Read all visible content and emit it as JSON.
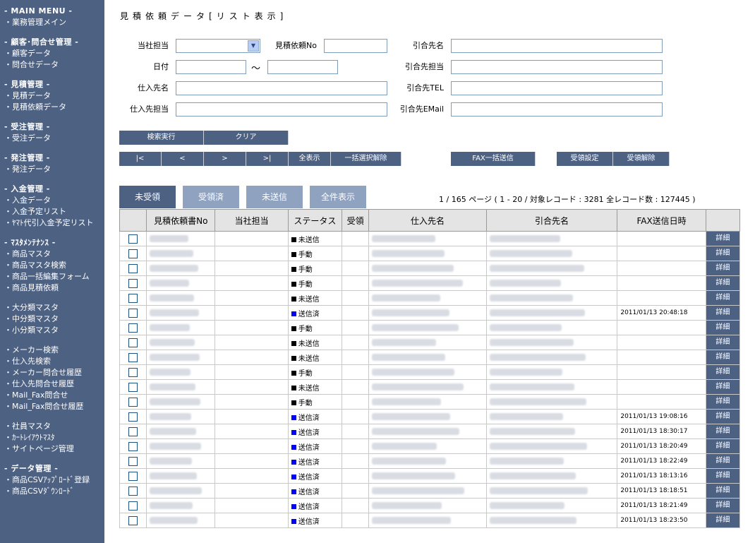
{
  "sidebar": {
    "groups": [
      {
        "head": "- MAIN MENU -",
        "items": [
          "・業務管理メイン"
        ]
      },
      {
        "head": "- 顧客･問合せ管理 -",
        "items": [
          "・顧客データ",
          "・問合せデータ"
        ]
      },
      {
        "head": "- 見積管理 -",
        "items": [
          "・見積データ",
          "・見積依頼データ"
        ]
      },
      {
        "head": "- 受注管理 -",
        "items": [
          "・受注データ"
        ]
      },
      {
        "head": "- 発注管理 -",
        "items": [
          "・発注データ"
        ]
      },
      {
        "head": "- 入金管理 -",
        "items": [
          "・入金データ",
          "・入金予定リスト",
          "・ﾔﾏﾄ代引入金予定リスト"
        ]
      },
      {
        "head": "- ﾏｽﾀﾒﾝﾃﾅﾝｽ -",
        "items": [
          "・商品マスタ",
          "・商品マスタ検索",
          "・商品一括編集フォーム",
          "・商品見積依頼"
        ]
      },
      {
        "head": "",
        "items": [
          "・大分類マスタ",
          "・中分類マスタ",
          "・小分類マスタ"
        ]
      },
      {
        "head": "",
        "items": [
          "・メーカー検索",
          "・仕入先検索",
          "・メーカー問合せ履歴",
          "・仕入先問合せ履歴",
          "・Mail_Fax問合せ",
          "・Mail_Fax問合せ履歴"
        ]
      },
      {
        "head": "",
        "items": [
          "・社員マスタ",
          "・ｶｰﾄﾚｲｱｳﾄﾏｽﾀ",
          "・サイトページ管理"
        ]
      },
      {
        "head": "- データ管理 -",
        "items": [
          "・商品CSVｱｯﾌﾟﾛｰﾄﾞ登録",
          "・商品CSVﾀﾞｳﾝﾛｰﾄﾞ"
        ]
      }
    ]
  },
  "page_title": "見積依頼データ[リスト表示]",
  "form": {
    "staff_label": "当社担当",
    "request_no_label": "見積依頼No",
    "client_name_label": "引合先名",
    "date_label": "日付",
    "date_sep": "～",
    "client_staff_label": "引合先担当",
    "supplier_name_label": "仕入先名",
    "client_tel_label": "引合先TEL",
    "supplier_staff_label": "仕入先担当",
    "client_email_label": "引合先EMail"
  },
  "buttons": {
    "search": "検索実行",
    "clear": "クリア",
    "first": "|<",
    "prev": "<",
    "next": ">",
    "last": ">|",
    "show_all": "全表示",
    "deselect_all": "一括選択解除",
    "fax_send_all": "FAX一括送信",
    "receipt_set": "受領設定",
    "receipt_cancel": "受領解除"
  },
  "tabs": [
    "未受領",
    "受領済",
    "未送信",
    "全件表示"
  ],
  "pager_text": "1 / 165 ページ ( 1 - 20 / 対象レコード : 3281 全レコード数 : 127445 )",
  "table": {
    "headers": [
      "",
      "見積依頼書No",
      "当社担当",
      "ステータス",
      "受領",
      "仕入先名",
      "引合先名",
      "FAX送信日時",
      ""
    ],
    "detail_label": "詳細",
    "status_colors": {
      "未送信": "#000000",
      "手動": "#000000",
      "送信済": "#0000ff"
    },
    "rows": [
      {
        "status": "未送信",
        "fax": ""
      },
      {
        "status": "手動",
        "fax": ""
      },
      {
        "status": "手動",
        "fax": ""
      },
      {
        "status": "手動",
        "fax": ""
      },
      {
        "status": "未送信",
        "fax": ""
      },
      {
        "status": "送信済",
        "fax": "2011/01/13 20:48:18"
      },
      {
        "status": "手動",
        "fax": ""
      },
      {
        "status": "未送信",
        "fax": ""
      },
      {
        "status": "未送信",
        "fax": ""
      },
      {
        "status": "手動",
        "fax": ""
      },
      {
        "status": "未送信",
        "fax": ""
      },
      {
        "status": "手動",
        "fax": ""
      },
      {
        "status": "送信済",
        "fax": "2011/01/13 19:08:16"
      },
      {
        "status": "送信済",
        "fax": "2011/01/13 18:30:17"
      },
      {
        "status": "送信済",
        "fax": "2011/01/13 18:20:49"
      },
      {
        "status": "送信済",
        "fax": "2011/01/13 18:22:49"
      },
      {
        "status": "送信済",
        "fax": "2011/01/13 18:13:16"
      },
      {
        "status": "送信済",
        "fax": "2011/01/13 18:18:51"
      },
      {
        "status": "送信済",
        "fax": "2011/01/13 18:21:49"
      },
      {
        "status": "送信済",
        "fax": "2011/01/13 18:23:50"
      }
    ]
  },
  "colors": {
    "sidebar_bg": "#4d6183",
    "tab_inactive": "#8fa2c0"
  }
}
